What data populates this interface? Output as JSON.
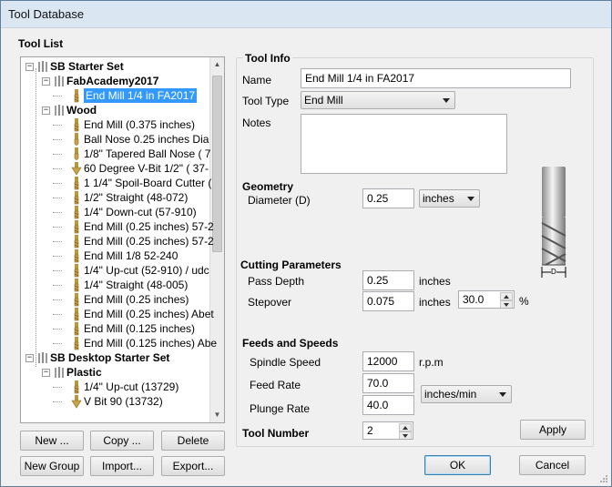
{
  "window": {
    "title": "Tool Database"
  },
  "tool_list": {
    "title": "Tool List",
    "tree": [
      {
        "label": "SB Starter Set",
        "bold": true,
        "kind": "group",
        "level": 0
      },
      {
        "label": "FabAcademy2017",
        "bold": true,
        "kind": "group",
        "level": 1
      },
      {
        "label": "End Mill 1/4 in FA2017",
        "kind": "endmill",
        "level": 2,
        "selected": true
      },
      {
        "label": "Wood",
        "bold": true,
        "kind": "group",
        "level": 1
      },
      {
        "label": "End Mill (0.375 inches)",
        "kind": "endmill",
        "level": 2
      },
      {
        "label": "Ball Nose 0.25 inches Dia",
        "kind": "ballnose",
        "level": 2
      },
      {
        "label": "1/8\" Tapered Ball Nose ( 7",
        "kind": "ballnose",
        "level": 2
      },
      {
        "label": "60 Degree V-Bit 1/2\"  ( 37-",
        "kind": "vbit",
        "level": 2
      },
      {
        "label": "1 1/4\" Spoil-Board Cutter (",
        "kind": "endmill",
        "level": 2
      },
      {
        "label": "1/2\" Straight  (48-072)",
        "kind": "endmill",
        "level": 2
      },
      {
        "label": "1/4\"  Down-cut (57-910)",
        "kind": "endmill",
        "level": 2
      },
      {
        "label": "End Mill (0.25 inches) 57-2",
        "kind": "endmill",
        "level": 2
      },
      {
        "label": "End Mill (0.25 inches) 57-2",
        "kind": "endmill",
        "level": 2
      },
      {
        "label": "End Mill 1/8 52-240",
        "kind": "endmill",
        "level": 2
      },
      {
        "label": "1/4\" Up-cut (52-910) / udc",
        "kind": "endmill",
        "level": 2
      },
      {
        "label": "1/4\" Straight  (48-005)",
        "kind": "endmill",
        "level": 2
      },
      {
        "label": "End Mill (0.25 inches)",
        "kind": "endmill",
        "level": 2
      },
      {
        "label": "End Mill (0.25 inches) Abet",
        "kind": "endmill",
        "level": 2
      },
      {
        "label": "End Mill (0.125 inches)",
        "kind": "endmill",
        "level": 2
      },
      {
        "label": "End Mill (0.125 inches) Abe",
        "kind": "endmill",
        "level": 2
      },
      {
        "label": "SB Desktop Starter Set",
        "bold": true,
        "kind": "group",
        "level": 0
      },
      {
        "label": "Plastic",
        "bold": true,
        "kind": "group",
        "level": 1
      },
      {
        "label": "1/4\" Up-cut (13729)",
        "kind": "endmill",
        "level": 2
      },
      {
        "label": "V Bit 90 (13732)",
        "kind": "vbit",
        "level": 2
      }
    ],
    "buttons": {
      "new": "New ...",
      "copy": "Copy ...",
      "delete": "Delete",
      "new_group": "New Group",
      "import": "Import...",
      "export": "Export..."
    }
  },
  "tool_info": {
    "title": "Tool Info",
    "name_label": "Name",
    "name_value": "End Mill 1/4 in FA2017",
    "tool_type_label": "Tool Type",
    "tool_type_value": "End Mill",
    "notes_label": "Notes",
    "notes_value": "",
    "geometry": {
      "title": "Geometry",
      "diameter_label": "Diameter (D)",
      "diameter_value": "0.25",
      "units_value": "inches"
    },
    "cutting": {
      "title": "Cutting Parameters",
      "pass_depth_label": "Pass Depth",
      "pass_depth_value": "0.25",
      "pass_depth_unit": "inches",
      "stepover_label": "Stepover",
      "stepover_value": "0.075",
      "stepover_unit": "inches",
      "stepover_percent": "30.0",
      "percent_sign": "%"
    },
    "feeds": {
      "title": "Feeds and Speeds",
      "spindle_label": "Spindle Speed",
      "spindle_value": "12000",
      "spindle_unit": "r.p.m",
      "feed_label": "Feed Rate",
      "feed_value": "70.0",
      "plunge_label": "Plunge Rate",
      "plunge_value": "40.0",
      "rate_units": "inches/min"
    },
    "tool_number_label": "Tool Number",
    "tool_number_value": "2",
    "diagram_label": "D",
    "apply": "Apply"
  },
  "dialog": {
    "ok": "OK",
    "cancel": "Cancel"
  },
  "colors": {
    "selection": "#3399ff",
    "titlebar": "#dbe6f3"
  }
}
